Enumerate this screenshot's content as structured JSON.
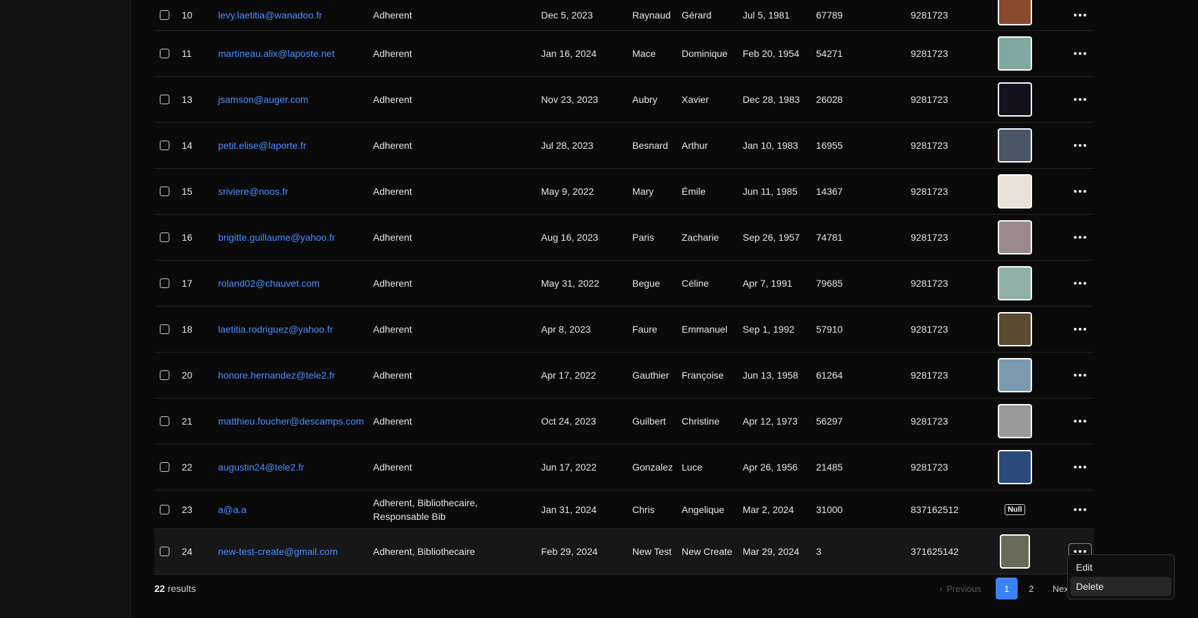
{
  "rows": [
    {
      "id": "10",
      "email": "levy.laetitia@wanadoo.fr",
      "roles": "Adherent",
      "date": "Dec 5, 2023",
      "last": "Raynaud",
      "first": "Gérard",
      "birth": "Jul 5, 1981",
      "code": "67789",
      "phone": "9281723",
      "photo": "#8a4a2c"
    },
    {
      "id": "11",
      "email": "martineau.alix@laposte.net",
      "roles": "Adherent",
      "date": "Jan 16, 2024",
      "last": "Mace",
      "first": "Dominique",
      "birth": "Feb 20, 1954",
      "code": "54271",
      "phone": "9281723",
      "photo": "#7fa8a0"
    },
    {
      "id": "13",
      "email": "jsamson@auger.com",
      "roles": "Adherent",
      "date": "Nov 23, 2023",
      "last": "Aubry",
      "first": "Xavier",
      "birth": "Dec 28, 1983",
      "code": "26028",
      "phone": "9281723",
      "photo": "#15101e"
    },
    {
      "id": "14",
      "email": "petit.elise@laporte.fr",
      "roles": "Adherent",
      "date": "Jul 28, 2023",
      "last": "Besnard",
      "first": "Arthur",
      "birth": "Jan 10, 1983",
      "code": "16955",
      "phone": "9281723",
      "photo": "#4a5566"
    },
    {
      "id": "15",
      "email": "sriviere@noos.fr",
      "roles": "Adherent",
      "date": "May 9, 2022",
      "last": "Mary",
      "first": "Émile",
      "birth": "Jun 11, 1985",
      "code": "14367",
      "phone": "9281723",
      "photo": "#e8e2d8"
    },
    {
      "id": "16",
      "email": "brigitte.guillaume@yahoo.fr",
      "roles": "Adherent",
      "date": "Aug 16, 2023",
      "last": "Paris",
      "first": "Zacharie",
      "birth": "Sep 26, 1957",
      "code": "74781",
      "phone": "9281723",
      "photo": "#9a8a8c"
    },
    {
      "id": "17",
      "email": "roland02@chauvet.com",
      "roles": "Adherent",
      "date": "May 31, 2022",
      "last": "Begue",
      "first": "Céline",
      "birth": "Apr 7, 1991",
      "code": "79685",
      "phone": "9281723",
      "photo": "#8fb0a8"
    },
    {
      "id": "18",
      "email": "laetitia.rodriguez@yahoo.fr",
      "roles": "Adherent",
      "date": "Apr 8, 2023",
      "last": "Faure",
      "first": "Emmanuel",
      "birth": "Sep 1, 1992",
      "code": "57910",
      "phone": "9281723",
      "photo": "#5a4a30"
    },
    {
      "id": "20",
      "email": "honore.hernandez@tele2.fr",
      "roles": "Adherent",
      "date": "Apr 17, 2022",
      "last": "Gauthier",
      "first": "Françoise",
      "birth": "Jun 13, 1958",
      "code": "61264",
      "phone": "9281723",
      "photo": "#7a9ab0"
    },
    {
      "id": "21",
      "email": "matthieu.foucher@descamps.com",
      "roles": "Adherent",
      "date": "Oct 24, 2023",
      "last": "Guilbert",
      "first": "Christine",
      "birth": "Apr 12, 1973",
      "code": "56297",
      "phone": "9281723",
      "photo": "#9a9a9a"
    },
    {
      "id": "22",
      "email": "augustin24@tele2.fr",
      "roles": "Adherent",
      "date": "Jun 17, 2022",
      "last": "Gonzalez",
      "first": "Luce",
      "birth": "Apr 26, 1956",
      "code": "21485",
      "phone": "9281723",
      "photo": "#2a4a7a"
    },
    {
      "id": "23",
      "email": "a@a.a",
      "roles": "Adherent, Bibliothecaire, Responsable Bib",
      "date": "Jan 31, 2024",
      "last": "Chris",
      "first": "Angelique",
      "birth": "Mar 2, 2024",
      "code": "31000",
      "phone": "837162512",
      "photo": "",
      "photo_null": "Null"
    },
    {
      "id": "24",
      "email": "new-test-create@gmail.com",
      "roles": "Adherent, Bibliothecaire",
      "date": "Feb 29, 2024",
      "last": "New Test",
      "first": "New Create",
      "birth": "Mar 29, 2024",
      "code": "3",
      "phone": "371625142",
      "photo": "#6a6a5a"
    }
  ],
  "footer": {
    "count": "22",
    "results_label": "results"
  },
  "pagination": {
    "previous": "Previous",
    "page1": "1",
    "page2": "2",
    "next": "Next"
  },
  "menu": {
    "edit": "Edit",
    "delete": "Delete"
  }
}
